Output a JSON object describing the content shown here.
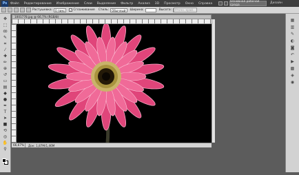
{
  "menubar": {
    "logo": "Ps",
    "items": [
      "Файл",
      "Редактирование",
      "Изображение",
      "Слои",
      "Выделение",
      "Фильтр",
      "Анализ",
      "3D",
      "Просмотр",
      "Окно",
      "Справка"
    ],
    "zoom": "66,7",
    "workspace_button": "Основная рабочая среда",
    "extra_label": "Дизайн"
  },
  "optbar": {
    "feather_label": "Растушевка:",
    "feather_value": "0 пикс",
    "antialias_label": "Сглаживание",
    "style_label": "Стиль:",
    "style_value": "Обычный",
    "width_label": "Ширина:",
    "height_label": "Высота:",
    "refine_button": "Уточн. край..."
  },
  "document": {
    "tab_title": "1001778.jpg @ 66,7% (RGB/8)",
    "status_zoom": "66,67%",
    "status_doc": "Док: 1,87M/1,46M"
  },
  "left_tools": [
    "move-tool",
    "marquee-tool",
    "lasso-tool",
    "quick-select-tool",
    "crop-tool",
    "eyedropper-tool",
    "healing-tool",
    "brush-tool",
    "clone-tool",
    "history-brush-tool",
    "eraser-tool",
    "gradient-tool",
    "blur-tool",
    "dodge-tool",
    "pen-tool",
    "type-tool",
    "path-select-tool",
    "shape-tool",
    "3d-rotate-tool",
    "3d-camera-tool",
    "hand-tool",
    "zoom-tool"
  ],
  "right_dock": [
    "layers-icon",
    "channels-icon",
    "paths-icon",
    "adjustments-icon",
    "masks-icon",
    "history-icon",
    "actions-icon",
    "swatches-icon",
    "styles-icon",
    "color-icon"
  ]
}
